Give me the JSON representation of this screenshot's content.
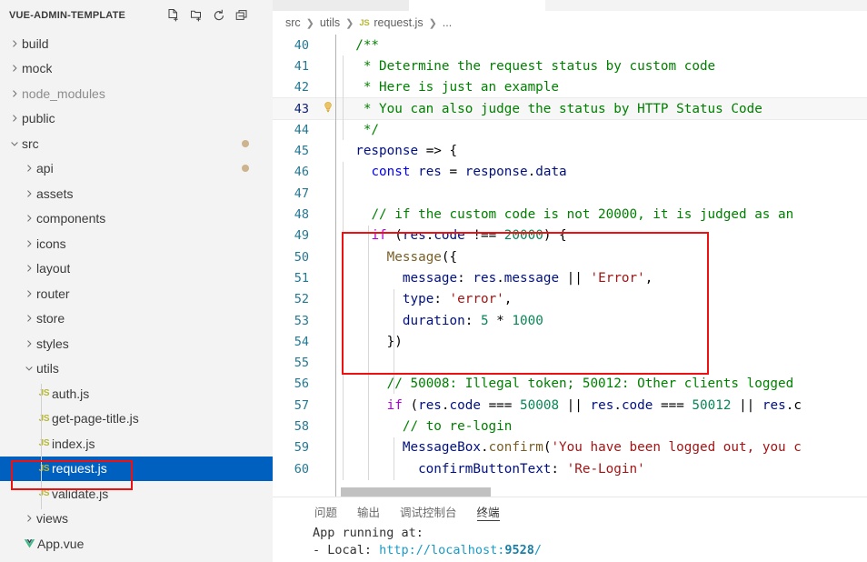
{
  "sidebar": {
    "title": "VUE-ADMIN-TEMPLATE",
    "actions": [
      {
        "name": "new-file-icon",
        "label": "New File"
      },
      {
        "name": "new-folder-icon",
        "label": "New Folder"
      },
      {
        "name": "refresh-icon",
        "label": "Refresh Explorer"
      },
      {
        "name": "collapse-all-icon",
        "label": "Collapse Folders in Explorer"
      }
    ],
    "tree": [
      {
        "label": "build",
        "type": "folder",
        "state": "collapsed",
        "depth": 0
      },
      {
        "label": "mock",
        "type": "folder",
        "state": "collapsed",
        "depth": 0
      },
      {
        "label": "node_modules",
        "type": "folder",
        "state": "collapsed",
        "depth": 0,
        "dim": true
      },
      {
        "label": "public",
        "type": "folder",
        "state": "collapsed",
        "depth": 0
      },
      {
        "label": "src",
        "type": "folder",
        "state": "expanded",
        "depth": 0,
        "dot": true
      },
      {
        "label": "api",
        "type": "folder",
        "state": "collapsed",
        "depth": 1,
        "dot": true
      },
      {
        "label": "assets",
        "type": "folder",
        "state": "collapsed",
        "depth": 1
      },
      {
        "label": "components",
        "type": "folder",
        "state": "collapsed",
        "depth": 1
      },
      {
        "label": "icons",
        "type": "folder",
        "state": "collapsed",
        "depth": 1
      },
      {
        "label": "layout",
        "type": "folder",
        "state": "collapsed",
        "depth": 1
      },
      {
        "label": "router",
        "type": "folder",
        "state": "collapsed",
        "depth": 1
      },
      {
        "label": "store",
        "type": "folder",
        "state": "collapsed",
        "depth": 1
      },
      {
        "label": "styles",
        "type": "folder",
        "state": "collapsed",
        "depth": 1
      },
      {
        "label": "utils",
        "type": "folder",
        "state": "expanded",
        "depth": 1
      },
      {
        "label": "auth.js",
        "type": "js",
        "depth": 2
      },
      {
        "label": "get-page-title.js",
        "type": "js",
        "depth": 2
      },
      {
        "label": "index.js",
        "type": "js",
        "depth": 2
      },
      {
        "label": "request.js",
        "type": "js",
        "depth": 2,
        "selected": true,
        "annotated": true
      },
      {
        "label": "validate.js",
        "type": "js",
        "depth": 2
      },
      {
        "label": "views",
        "type": "folder",
        "state": "collapsed",
        "depth": 1
      },
      {
        "label": "App.vue",
        "type": "vue",
        "depth": 1
      }
    ]
  },
  "breadcrumb": {
    "items": [
      "src",
      "utils",
      "request.js",
      "..."
    ],
    "file_icon": "JS"
  },
  "editor": {
    "first_line": 40,
    "current_line": 43,
    "lines": [
      {
        "n": 40,
        "tokens": [
          {
            "t": "  ",
            "c": "op"
          },
          {
            "t": "/**",
            "c": "cm"
          }
        ]
      },
      {
        "n": 41,
        "tokens": [
          {
            "t": "   * Determine the request status by custom code",
            "c": "cm"
          }
        ]
      },
      {
        "n": 42,
        "tokens": [
          {
            "t": "   * Here is just an example",
            "c": "cm"
          }
        ]
      },
      {
        "n": 43,
        "bulb": true,
        "tokens": [
          {
            "t": "   * You can also judge the status by HTTP Status Code",
            "c": "cm"
          }
        ]
      },
      {
        "n": 44,
        "tokens": [
          {
            "t": "   */",
            "c": "cm"
          }
        ]
      },
      {
        "n": 45,
        "tokens": [
          {
            "t": "  ",
            "c": "op"
          },
          {
            "t": "response",
            "c": "va"
          },
          {
            "t": " => {",
            "c": "op"
          }
        ]
      },
      {
        "n": 46,
        "tokens": [
          {
            "t": "    ",
            "c": "op"
          },
          {
            "t": "const",
            "c": "kw"
          },
          {
            "t": " ",
            "c": "op"
          },
          {
            "t": "res",
            "c": "va"
          },
          {
            "t": " = ",
            "c": "op"
          },
          {
            "t": "response",
            "c": "va"
          },
          {
            "t": ".",
            "c": "op"
          },
          {
            "t": "data",
            "c": "va"
          }
        ]
      },
      {
        "n": 47,
        "tokens": [
          {
            "t": "",
            "c": "op"
          }
        ]
      },
      {
        "n": 48,
        "tokens": [
          {
            "t": "    ",
            "c": "op"
          },
          {
            "t": "// if the custom code is not 20000, it is judged as an ",
            "c": "cm"
          }
        ]
      },
      {
        "n": 49,
        "tokens": [
          {
            "t": "    ",
            "c": "op"
          },
          {
            "t": "if",
            "c": "kwp"
          },
          {
            "t": " (",
            "c": "op"
          },
          {
            "t": "res",
            "c": "va"
          },
          {
            "t": ".",
            "c": "op"
          },
          {
            "t": "code",
            "c": "va"
          },
          {
            "t": " !== ",
            "c": "op"
          },
          {
            "t": "20000",
            "c": "num"
          },
          {
            "t": ") {",
            "c": "op"
          }
        ]
      },
      {
        "n": 50,
        "tokens": [
          {
            "t": "      ",
            "c": "op"
          },
          {
            "t": "Message",
            "c": "fn"
          },
          {
            "t": "({",
            "c": "op"
          }
        ]
      },
      {
        "n": 51,
        "tokens": [
          {
            "t": "        ",
            "c": "op"
          },
          {
            "t": "message",
            "c": "va"
          },
          {
            "t": ": ",
            "c": "op"
          },
          {
            "t": "res",
            "c": "va"
          },
          {
            "t": ".",
            "c": "op"
          },
          {
            "t": "message",
            "c": "va"
          },
          {
            "t": " || ",
            "c": "op"
          },
          {
            "t": "'Error'",
            "c": "str"
          },
          {
            "t": ",",
            "c": "op"
          }
        ]
      },
      {
        "n": 52,
        "tokens": [
          {
            "t": "        ",
            "c": "op"
          },
          {
            "t": "type",
            "c": "va"
          },
          {
            "t": ": ",
            "c": "op"
          },
          {
            "t": "'error'",
            "c": "str"
          },
          {
            "t": ",",
            "c": "op"
          }
        ]
      },
      {
        "n": 53,
        "tokens": [
          {
            "t": "        ",
            "c": "op"
          },
          {
            "t": "duration",
            "c": "va"
          },
          {
            "t": ": ",
            "c": "op"
          },
          {
            "t": "5",
            "c": "num"
          },
          {
            "t": " * ",
            "c": "op"
          },
          {
            "t": "1000",
            "c": "num"
          }
        ]
      },
      {
        "n": 54,
        "tokens": [
          {
            "t": "      })",
            "c": "op"
          }
        ]
      },
      {
        "n": 55,
        "tokens": [
          {
            "t": "",
            "c": "op"
          }
        ]
      },
      {
        "n": 56,
        "tokens": [
          {
            "t": "      ",
            "c": "op"
          },
          {
            "t": "// 50008: Illegal token; 50012: Other clients logged ",
            "c": "cm"
          }
        ]
      },
      {
        "n": 57,
        "tokens": [
          {
            "t": "      ",
            "c": "op"
          },
          {
            "t": "if",
            "c": "kwp"
          },
          {
            "t": " (",
            "c": "op"
          },
          {
            "t": "res",
            "c": "va"
          },
          {
            "t": ".",
            "c": "op"
          },
          {
            "t": "code",
            "c": "va"
          },
          {
            "t": " === ",
            "c": "op"
          },
          {
            "t": "50008",
            "c": "num"
          },
          {
            "t": " || ",
            "c": "op"
          },
          {
            "t": "res",
            "c": "va"
          },
          {
            "t": ".",
            "c": "op"
          },
          {
            "t": "code",
            "c": "va"
          },
          {
            "t": " === ",
            "c": "op"
          },
          {
            "t": "50012",
            "c": "num"
          },
          {
            "t": " || ",
            "c": "op"
          },
          {
            "t": "res",
            "c": "va"
          },
          {
            "t": ".c",
            "c": "op"
          }
        ]
      },
      {
        "n": 58,
        "tokens": [
          {
            "t": "        ",
            "c": "op"
          },
          {
            "t": "// to re-login",
            "c": "cm"
          }
        ]
      },
      {
        "n": 59,
        "tokens": [
          {
            "t": "        ",
            "c": "op"
          },
          {
            "t": "MessageBox",
            "c": "va"
          },
          {
            "t": ".",
            "c": "op"
          },
          {
            "t": "confirm",
            "c": "fn"
          },
          {
            "t": "(",
            "c": "op"
          },
          {
            "t": "'You have been logged out, you c",
            "c": "str"
          }
        ]
      },
      {
        "n": 60,
        "tokens": [
          {
            "t": "          ",
            "c": "op"
          },
          {
            "t": "confirmButtonText",
            "c": "va"
          },
          {
            "t": ": ",
            "c": "op"
          },
          {
            "t": "'Re-Login'",
            "c": "str"
          }
        ]
      }
    ]
  },
  "panel": {
    "tabs": [
      {
        "label": "问题",
        "active": false
      },
      {
        "label": "输出",
        "active": false
      },
      {
        "label": "调试控制台",
        "active": false
      },
      {
        "label": "终端",
        "active": true
      }
    ],
    "terminal": {
      "line1": "App running at:",
      "line2_label": "  - Local:   ",
      "line2_url": "http://localhost:",
      "line2_port": "9528",
      "line2_tail": "/"
    }
  },
  "colors": {
    "selection": "#0060c0",
    "annotation": "#ee1111",
    "comment": "#008000",
    "keyword": "#0000ff",
    "string": "#a31515",
    "number": "#098658",
    "linenumber": "#237893",
    "js_icon": "#b7b73b",
    "vue_icon": "#41b883",
    "modified_dot": "#cdb38e"
  }
}
